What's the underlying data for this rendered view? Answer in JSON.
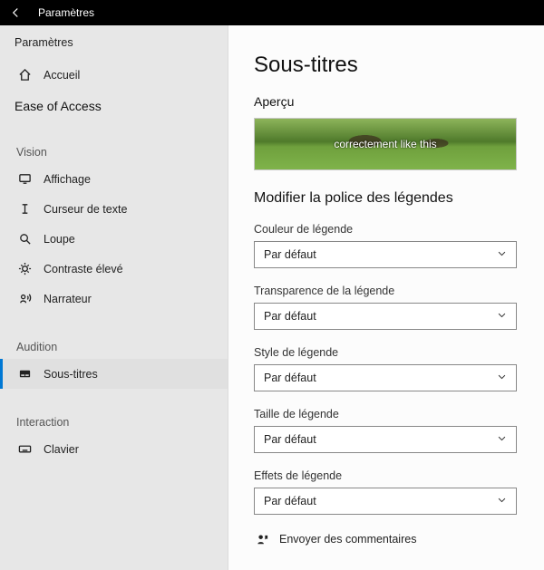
{
  "titlebar": {
    "title": "Paramètres"
  },
  "sidebar": {
    "header": "Paramètres",
    "home": "Accueil",
    "ease_of_access": "Ease of Access",
    "groups": {
      "vision": {
        "label": "Vision",
        "items": [
          {
            "label": "Affichage"
          },
          {
            "label": "Curseur de texte"
          },
          {
            "label": "Loupe"
          },
          {
            "label": "Contraste élevé"
          },
          {
            "label": "Narrateur"
          }
        ]
      },
      "audition": {
        "label": "Audition",
        "items": [
          {
            "label": "Sous-titres"
          }
        ]
      },
      "interaction": {
        "label": "Interaction",
        "items": [
          {
            "label": "Clavier"
          }
        ]
      }
    }
  },
  "main": {
    "title": "Sous-titres",
    "preview_label": "Aperçu",
    "preview_caption": "correctement like this",
    "section_title": "Modifier la police des légendes",
    "fields": {
      "color": {
        "label": "Couleur de légende",
        "value": "Par défaut"
      },
      "transparency": {
        "label": "Transparence de la légende",
        "value": "Par défaut"
      },
      "style": {
        "label": "Style de légende",
        "value": "Par défaut"
      },
      "size": {
        "label": "Taille de légende",
        "value": "Par défaut"
      },
      "effects": {
        "label": "Effets de légende",
        "value": "Par défaut"
      }
    },
    "feedback": "Envoyer des commentaires"
  }
}
